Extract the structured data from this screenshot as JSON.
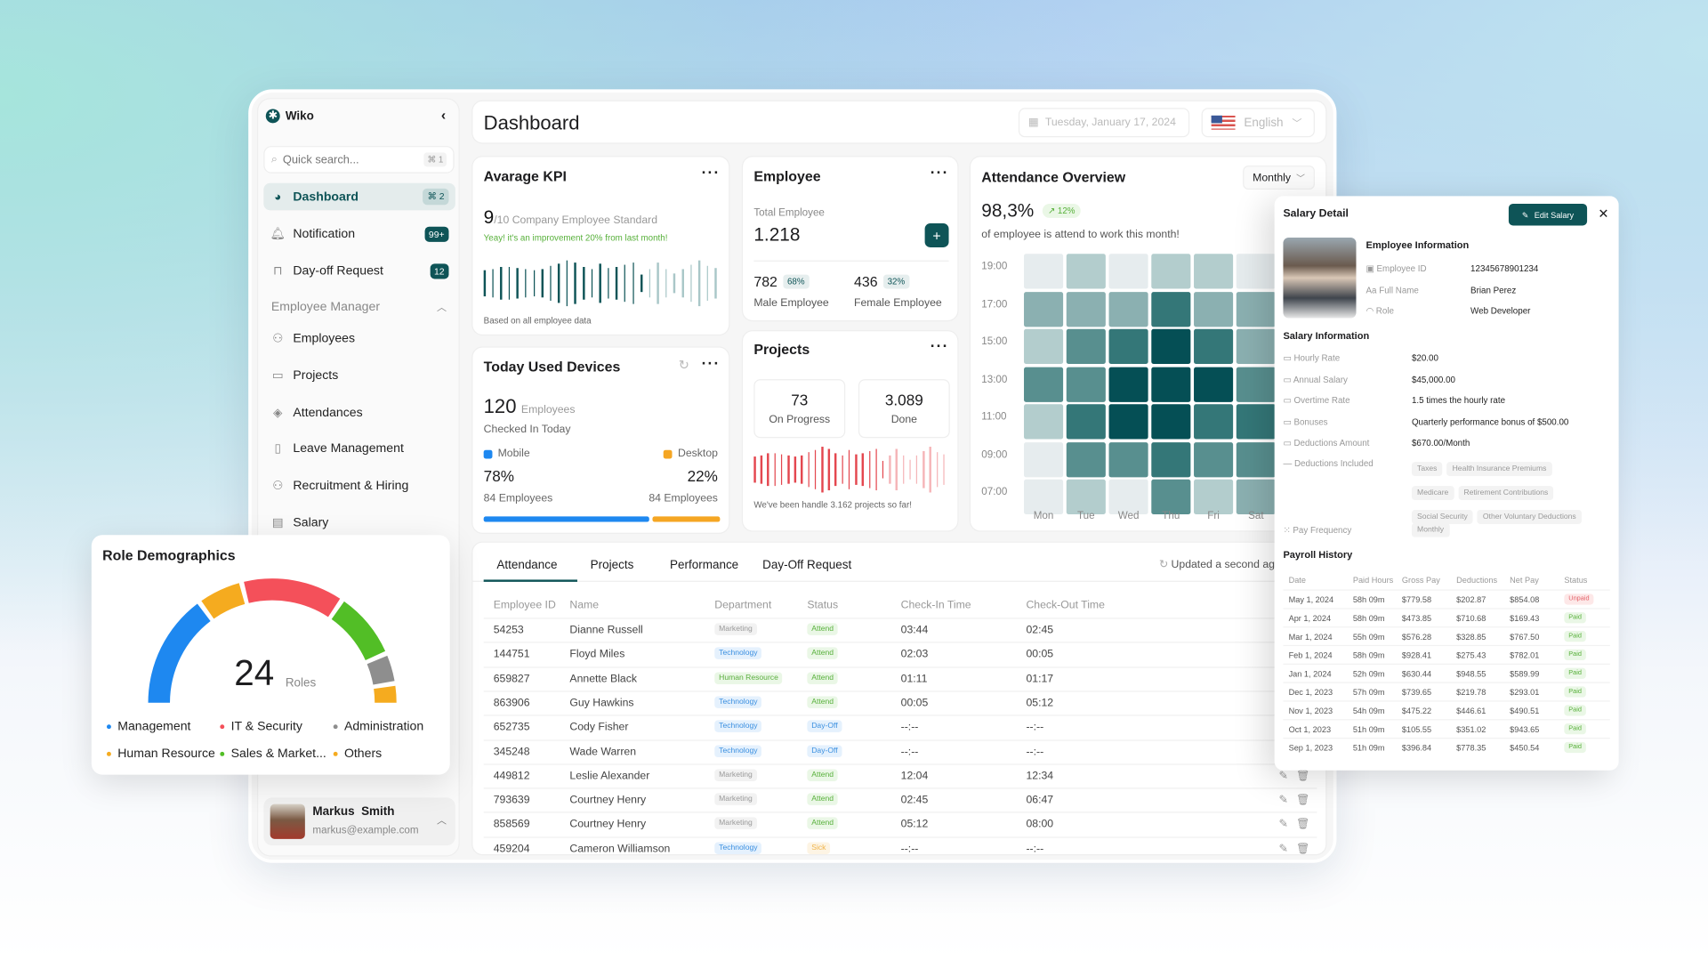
{
  "app": {
    "name": "Wiko"
  },
  "sidebar": {
    "search_placeholder": "Quick search...",
    "search_shortcut": "⌘ 1",
    "items": [
      {
        "label": "Dashboard",
        "icon": "pie-chart-icon",
        "badge": "⌘ 2",
        "active": true
      },
      {
        "label": "Notification",
        "icon": "bell-icon",
        "badge": "99+"
      },
      {
        "label": "Day-off Request",
        "icon": "bag-icon",
        "badge": "12"
      }
    ],
    "section": "Employee Manager",
    "section_items": [
      {
        "label": "Employees",
        "icon": "user-icon"
      },
      {
        "label": "Projects",
        "icon": "folder-icon"
      },
      {
        "label": "Attendances",
        "icon": "layers-icon"
      },
      {
        "label": "Leave Management",
        "icon": "file-icon"
      },
      {
        "label": "Recruitment & Hiring",
        "icon": "user-plus-icon"
      },
      {
        "label": "Salary",
        "icon": "receipt-icon"
      }
    ],
    "user": {
      "name": "Markus  Smith",
      "email": "markus@example.com"
    }
  },
  "header": {
    "title": "Dashboard",
    "date": "Tuesday, January 17, 2024",
    "language": "English"
  },
  "kpi": {
    "title": "Avarage KPI",
    "score": "9",
    "out_of": "/10",
    "caption": "Company Employee Standard",
    "improvement": "Yeay! it's an improvement 20% from last month!",
    "footer": "Based on all employee data",
    "bars": [
      0.55,
      0.6,
      0.7,
      0.72,
      0.65,
      0.6,
      0.55,
      0.62,
      0.75,
      0.85,
      1.0,
      0.9,
      0.7,
      0.6,
      0.85,
      0.65,
      0.7,
      0.8,
      0.9,
      0.4,
      0.6,
      0.9,
      0.6,
      0.45,
      0.6,
      0.8,
      1.0,
      0.75,
      0.65
    ]
  },
  "employee": {
    "title": "Employee",
    "total_label": "Total Employee",
    "total": "1.218",
    "male": "782",
    "male_pct": "68%",
    "male_label": "Male Employee",
    "female": "436",
    "female_pct": "32%",
    "female_label": "Female Employee"
  },
  "devices": {
    "title": "Today Used Devices",
    "count": "120",
    "count_unit": "Employees",
    "checked": "Checked In Today",
    "mobile_label": "Mobile",
    "desktop_label": "Desktop",
    "mobile_pct": "78%",
    "desktop_pct": "22%",
    "mobile_count": "84 Employees",
    "desktop_count": "84 Employees",
    "mobile_share": 78,
    "colors": {
      "mobile": "#1e88f0",
      "desktop": "#f5a623"
    }
  },
  "projects": {
    "title": "Projects",
    "on_progress": "73",
    "on_progress_label": "On Progress",
    "done": "3.089",
    "done_label": "Done",
    "footer": "We've been handle 3.162 projects so far!",
    "bars": [
      0.55,
      0.6,
      0.7,
      0.72,
      0.65,
      0.6,
      0.55,
      0.62,
      0.75,
      0.85,
      1.0,
      0.9,
      0.7,
      0.6,
      0.85,
      0.65,
      0.7,
      0.8,
      0.9,
      0.4,
      0.6,
      0.9,
      0.6,
      0.45,
      0.6,
      0.8,
      1.0,
      0.75,
      0.65
    ]
  },
  "attendance": {
    "title": "Attendance Overview",
    "period": "Monthly",
    "rate": "98,3%",
    "trend": "12%",
    "caption": "of employee is attend to work this month!",
    "hours": [
      "19:00",
      "17:00",
      "15:00",
      "13:00",
      "11:00",
      "09:00",
      "07:00"
    ],
    "days": [
      "Mon",
      "Tue",
      "Wed",
      "Thu",
      "Fri",
      "Sat"
    ],
    "levels": [
      [
        0,
        1,
        0,
        1,
        1,
        0
      ],
      [
        2,
        2,
        2,
        4,
        2,
        2
      ],
      [
        1,
        3,
        4,
        5,
        4,
        2
      ],
      [
        3,
        3,
        5,
        5,
        5,
        3
      ],
      [
        1,
        4,
        5,
        5,
        4,
        4
      ],
      [
        0,
        3,
        3,
        4,
        3,
        3
      ],
      [
        0,
        1,
        0,
        3,
        1,
        2
      ]
    ]
  },
  "table": {
    "tabs": [
      "Attendance",
      "Projects",
      "Performance",
      "Day-Off Request"
    ],
    "updated": "Updated a second ago",
    "columns": [
      "Employee ID",
      "Name",
      "Department",
      "Status",
      "Check-In Time",
      "Check-Out Time"
    ],
    "rows": [
      [
        "54253",
        "Dianne Russell",
        "Marketing",
        "Attend",
        "03:44",
        "02:45"
      ],
      [
        "144751",
        "Floyd Miles",
        "Technology",
        "Attend",
        "02:03",
        "00:05"
      ],
      [
        "659827",
        "Annette Black",
        "Human Resource",
        "Attend",
        "01:11",
        "01:17"
      ],
      [
        "863906",
        "Guy Hawkins",
        "Technology",
        "Attend",
        "00:05",
        "05:12"
      ],
      [
        "652735",
        "Cody Fisher",
        "Technology",
        "Day-Off",
        "--:--",
        "--:--"
      ],
      [
        "345248",
        "Wade Warren",
        "Technology",
        "Day-Off",
        "--:--",
        "--:--"
      ],
      [
        "449812",
        "Leslie Alexander",
        "Marketing",
        "Attend",
        "12:04",
        "12:34"
      ],
      [
        "793639",
        "Courtney Henry",
        "Marketing",
        "Attend",
        "02:45",
        "06:47"
      ],
      [
        "858569",
        "Courtney Henry",
        "Marketing",
        "Attend",
        "05:12",
        "08:00"
      ],
      [
        "459204",
        "Cameron Williamson",
        "Technology",
        "Sick",
        "--:--",
        "--:--"
      ]
    ]
  },
  "roles": {
    "title": "Role Demographics",
    "count": "24",
    "unit": "Roles",
    "segments": [
      {
        "name": "Management",
        "share": 0.3,
        "color": "#1e88f0"
      },
      {
        "name": "Human Resource",
        "share": 0.12,
        "color": "#f5ab1f"
      },
      {
        "name": "IT & Security",
        "share": 0.27,
        "color": "#f4505a"
      },
      {
        "name": "Sales & Market...",
        "share": 0.18,
        "color": "#52be26"
      },
      {
        "name": "Administration",
        "share": 0.08,
        "color": "#8e8e8e"
      },
      {
        "name": "Others",
        "share": 0.05,
        "color": "#f5ab1f"
      }
    ]
  },
  "salary": {
    "title": "Salary Detail",
    "edit": "Edit Salary",
    "emp_heading": "Employee Information",
    "emp_fields": [
      {
        "label": "Employee ID",
        "value": "12345678901234"
      },
      {
        "label": "Full Name",
        "value": "Brian Perez"
      },
      {
        "label": "Role",
        "value": "Web Developer"
      }
    ],
    "sal_heading": "Salary Information",
    "sal_fields": [
      {
        "label": "Hourly Rate",
        "value": "$20.00"
      },
      {
        "label": "Annual Salary",
        "value": "$45,000.00"
      },
      {
        "label": "Overtime Rate",
        "value": "1.5 times the hourly rate"
      },
      {
        "label": "Bonuses",
        "value": "Quarterly performance bonus of $500.00"
      },
      {
        "label": "Deductions Amount",
        "value": "$670.00/Month"
      }
    ],
    "deductions_label": "Deductions Included",
    "deductions": [
      "Taxes",
      "Health Insurance Premiums",
      "Medicare",
      "Retirement Contributions",
      "Social Security",
      "Other Voluntary Deductions"
    ],
    "pay_freq_label": "Pay Frequency",
    "pay_freq": "Monthly",
    "payroll_heading": "Payroll History",
    "payroll_columns": [
      "Date",
      "Paid Hours",
      "Gross Pay",
      "Deductions",
      "Net Pay",
      "Status"
    ],
    "payroll": [
      [
        "May 1, 2024",
        "58h 09m",
        "$779.58",
        "$202.87",
        "$854.08",
        "Unpaid"
      ],
      [
        "Apr 1, 2024",
        "58h 09m",
        "$473.85",
        "$710.68",
        "$169.43",
        "Paid"
      ],
      [
        "Mar 1, 2024",
        "55h 09m",
        "$576.28",
        "$328.85",
        "$767.50",
        "Paid"
      ],
      [
        "Feb 1, 2024",
        "58h 09m",
        "$928.41",
        "$275.43",
        "$782.01",
        "Paid"
      ],
      [
        "Jan 1, 2024",
        "52h 09m",
        "$630.44",
        "$948.55",
        "$589.99",
        "Paid"
      ],
      [
        "Dec 1, 2023",
        "57h 09m",
        "$739.65",
        "$219.78",
        "$293.01",
        "Paid"
      ],
      [
        "Nov 1, 2023",
        "54h 09m",
        "$475.22",
        "$446.61",
        "$490.51",
        "Paid"
      ],
      [
        "Oct 1, 2023",
        "51h 09m",
        "$105.55",
        "$351.02",
        "$943.65",
        "Paid"
      ],
      [
        "Sep 1, 2023",
        "51h 09m",
        "$396.84",
        "$778.35",
        "$450.54",
        "Paid"
      ]
    ]
  },
  "colors": {
    "brand": "#0e5457",
    "positive": "#57b03a",
    "danger": "#f4505a"
  }
}
